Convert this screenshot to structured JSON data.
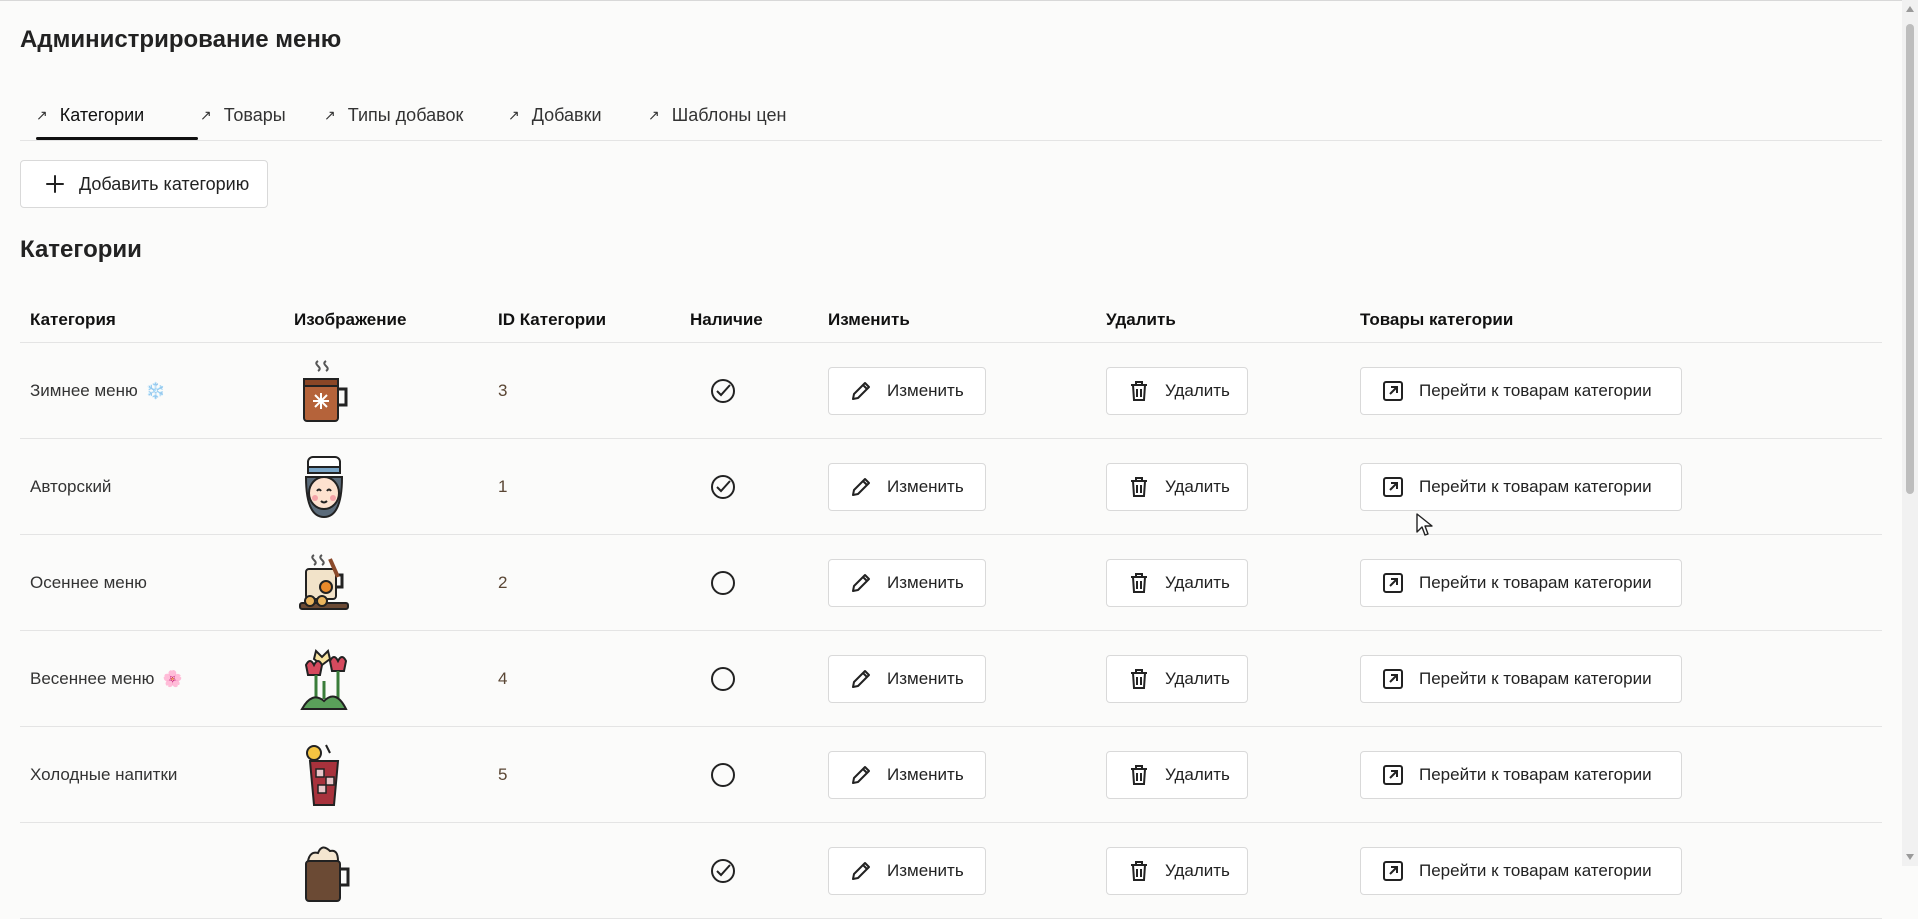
{
  "page": {
    "title": "Администрирование меню"
  },
  "tabs": [
    {
      "label": "Категории",
      "active": true
    },
    {
      "label": "Товары",
      "active": false
    },
    {
      "label": "Типы добавок",
      "active": false
    },
    {
      "label": "Добавки",
      "active": false
    },
    {
      "label": "Шаблоны цен",
      "active": false
    }
  ],
  "toolbar": {
    "add_label": "Добавить категорию"
  },
  "section": {
    "title": "Категории"
  },
  "table": {
    "headers": [
      "Категория",
      "Изображение",
      "ID Категории",
      "Наличие",
      "Изменить",
      "Удалить",
      "Товары категории"
    ],
    "rows": [
      {
        "name": "Зимнее меню",
        "emoji": "❄️",
        "image": "hot-cocoa-mug-icon",
        "id": "3",
        "available": true
      },
      {
        "name": "Авторский",
        "emoji": "",
        "image": "chef-girl-icon",
        "id": "1",
        "available": true
      },
      {
        "name": "Осеннее меню",
        "emoji": "",
        "image": "autumn-drink-cookies-icon",
        "id": "2",
        "available": false
      },
      {
        "name": "Весеннее меню",
        "emoji": "🌸",
        "image": "tulips-icon",
        "id": "4",
        "available": false
      },
      {
        "name": "Холодные напитки",
        "emoji": "",
        "image": "iced-drink-icon",
        "id": "5",
        "available": false
      },
      {
        "name": "",
        "emoji": "",
        "image": "whipped-cream-mug-icon",
        "id": "",
        "available": true
      }
    ],
    "actions": {
      "edit_label": "Изменить",
      "delete_label": "Удалить",
      "goto_label": "Перейти к товарам категории"
    }
  },
  "colors": {
    "accent": "#111111",
    "border": "#d9d9d9",
    "background": "#fbfbfa",
    "id_text": "#5a4634"
  }
}
